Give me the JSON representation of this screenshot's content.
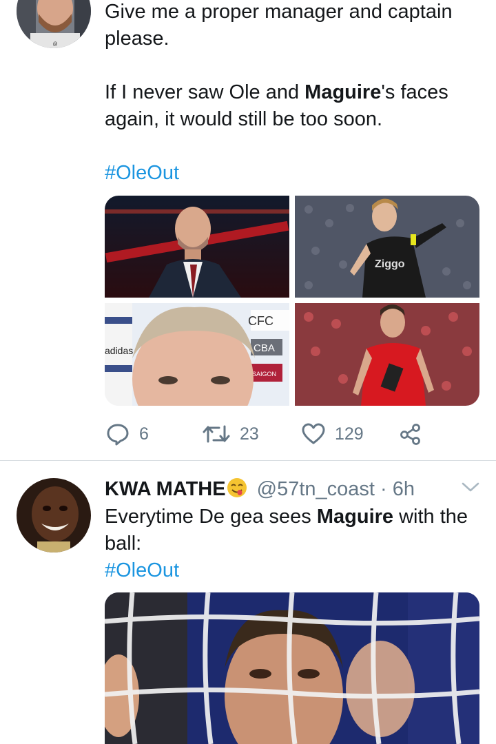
{
  "tweet1": {
    "text_line1": "Give me a proper manager and captain please.",
    "text_pre": "If I never saw Ole and ",
    "text_bold": "Maguire",
    "text_post": "'s faces again, it would still be too soon.",
    "hashtag": "#OleOut",
    "stats": {
      "replies": "6",
      "retweets": "23",
      "likes": "129"
    },
    "photos": [
      "manager-portrait",
      "player-in-ajax-kit",
      "interview-closeup",
      "player-in-red-kit"
    ],
    "sponsor_texts": {
      "ziggo": "Ziggo",
      "adidas": "adidas",
      "cfc": "CFC",
      "cba": "CBA",
      "saigon": "SAIGON"
    }
  },
  "tweet2": {
    "display_name": "KWA MATHE",
    "emoji_name": "savoring-face-emoji",
    "handle": "@57tn_coast",
    "separator": "·",
    "time": "6h",
    "text_pre": "Everytime De gea sees ",
    "text_bold": "Maguire",
    "text_post": " with the ball:",
    "hashtag": "#OleOut"
  },
  "colors": {
    "accent": "#1b95e0",
    "muted": "#657786",
    "divider": "#d8dde1"
  },
  "icons": [
    "reply-icon",
    "retweet-icon",
    "like-icon",
    "share-icon",
    "chevron-down-icon"
  ]
}
